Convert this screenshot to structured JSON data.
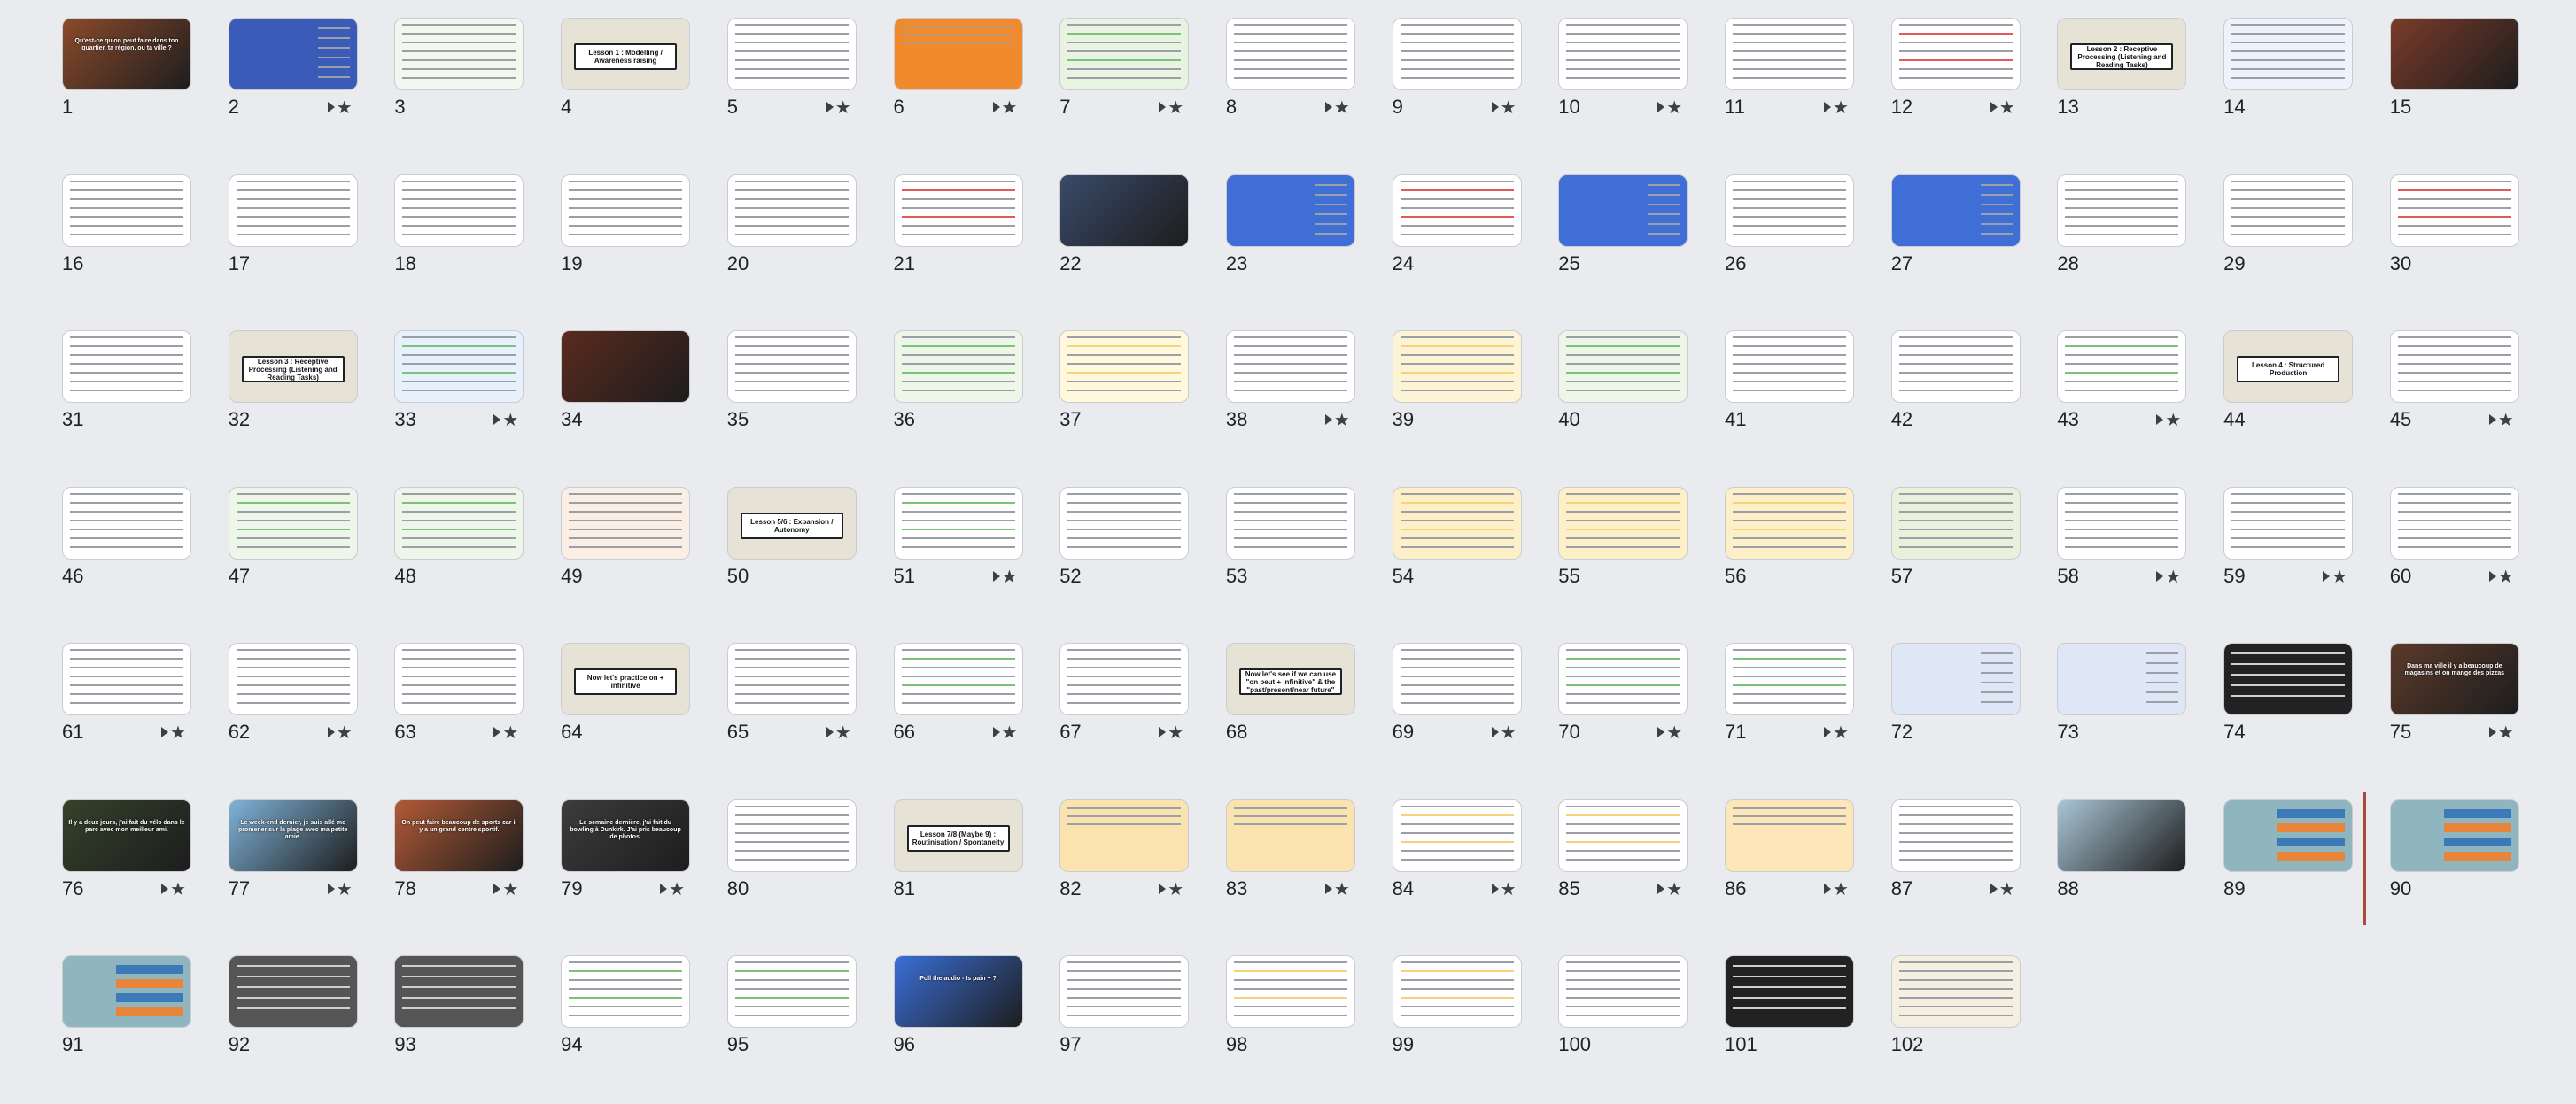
{
  "slide_sorter": {
    "slides": [
      {
        "n": "1",
        "star": false,
        "kind": "image",
        "bg": "#8b4a2b",
        "text": "Qu'est-ce qu'on peut faire dans ton quartier, ta région, ou ta ville ?"
      },
      {
        "n": "2",
        "star": true,
        "kind": "blue",
        "bg": "#3b5bb8"
      },
      {
        "n": "3",
        "star": false,
        "kind": "doc",
        "bg": "#f4f6f0"
      },
      {
        "n": "4",
        "star": false,
        "kind": "title",
        "bg": "#e6e2d6",
        "text": "Lesson 1 : Modelling / Awareness raising"
      },
      {
        "n": "5",
        "star": true,
        "kind": "doc",
        "bg": "#ffffff"
      },
      {
        "n": "6",
        "star": true,
        "kind": "orange",
        "bg": "#f08a2c"
      },
      {
        "n": "7",
        "star": true,
        "kind": "green",
        "bg": "#e9f3e2"
      },
      {
        "n": "8",
        "star": true,
        "kind": "doc",
        "bg": "#ffffff"
      },
      {
        "n": "9",
        "star": true,
        "kind": "doc",
        "bg": "#ffffff"
      },
      {
        "n": "10",
        "star": true,
        "kind": "doc",
        "bg": "#ffffff"
      },
      {
        "n": "11",
        "star": true,
        "kind": "doc",
        "bg": "#ffffff"
      },
      {
        "n": "12",
        "star": true,
        "kind": "red",
        "bg": "#ffffff"
      },
      {
        "n": "13",
        "star": false,
        "kind": "title",
        "bg": "#e6e2d6",
        "text": "Lesson 2 : Receptive Processing (Listening and Reading Tasks)"
      },
      {
        "n": "14",
        "star": false,
        "kind": "doc",
        "bg": "#eef3fb"
      },
      {
        "n": "15",
        "star": false,
        "kind": "image",
        "bg": "#7a3b2a",
        "text": ""
      },
      {
        "n": "16",
        "star": false,
        "kind": "doc",
        "bg": "#ffffff"
      },
      {
        "n": "17",
        "star": false,
        "kind": "doc",
        "bg": "#ffffff"
      },
      {
        "n": "18",
        "star": false,
        "kind": "doc",
        "bg": "#ffffff"
      },
      {
        "n": "19",
        "star": false,
        "kind": "doc",
        "bg": "#ffffff"
      },
      {
        "n": "20",
        "star": false,
        "kind": "doc",
        "bg": "#ffffff"
      },
      {
        "n": "21",
        "star": false,
        "kind": "red",
        "bg": "#ffffff"
      },
      {
        "n": "22",
        "star": false,
        "kind": "image",
        "bg": "#3a4a6a",
        "text": ""
      },
      {
        "n": "23",
        "star": false,
        "kind": "blue",
        "bg": "#3f6ed6"
      },
      {
        "n": "24",
        "star": false,
        "kind": "red",
        "bg": "#ffffff"
      },
      {
        "n": "25",
        "star": false,
        "kind": "blue",
        "bg": "#3f6ed6"
      },
      {
        "n": "26",
        "star": false,
        "kind": "doc",
        "bg": "#ffffff"
      },
      {
        "n": "27",
        "star": false,
        "kind": "blue",
        "bg": "#3f6ed6"
      },
      {
        "n": "28",
        "star": false,
        "kind": "doc",
        "bg": "#ffffff"
      },
      {
        "n": "29",
        "star": false,
        "kind": "doc",
        "bg": "#ffffff"
      },
      {
        "n": "30",
        "star": false,
        "kind": "red",
        "bg": "#ffffff"
      },
      {
        "n": "31",
        "star": false,
        "kind": "doc",
        "bg": "#ffffff"
      },
      {
        "n": "32",
        "star": false,
        "kind": "title",
        "bg": "#e6e2d6",
        "text": "Lesson 3 : Receptive Processing (Listening and Reading Tasks)"
      },
      {
        "n": "33",
        "star": true,
        "kind": "green",
        "bg": "#e7f1fb"
      },
      {
        "n": "34",
        "star": false,
        "kind": "image",
        "bg": "#5a2a1e",
        "text": ""
      },
      {
        "n": "35",
        "star": false,
        "kind": "doc",
        "bg": "#ffffff"
      },
      {
        "n": "36",
        "star": false,
        "kind": "green",
        "bg": "#eef6ea"
      },
      {
        "n": "37",
        "star": false,
        "kind": "yellow",
        "bg": "#fff8dc"
      },
      {
        "n": "38",
        "star": true,
        "kind": "doc",
        "bg": "#ffffff"
      },
      {
        "n": "39",
        "star": false,
        "kind": "yellow",
        "bg": "#fdf4d6"
      },
      {
        "n": "40",
        "star": false,
        "kind": "green",
        "bg": "#eef6ea"
      },
      {
        "n": "41",
        "star": false,
        "kind": "doc",
        "bg": "#ffffff"
      },
      {
        "n": "42",
        "star": false,
        "kind": "doc",
        "bg": "#ffffff"
      },
      {
        "n": "43",
        "star": true,
        "kind": "green",
        "bg": "#ffffff"
      },
      {
        "n": "44",
        "star": false,
        "kind": "title",
        "bg": "#e6e2d6",
        "text": "Lesson 4 : Structured Production"
      },
      {
        "n": "45",
        "star": true,
        "kind": "doc",
        "bg": "#ffffff"
      },
      {
        "n": "46",
        "star": false,
        "kind": "doc",
        "bg": "#ffffff"
      },
      {
        "n": "47",
        "star": false,
        "kind": "green",
        "bg": "#eef6ea"
      },
      {
        "n": "48",
        "star": false,
        "kind": "green",
        "bg": "#eef6ea"
      },
      {
        "n": "49",
        "star": false,
        "kind": "doc",
        "bg": "#fbeee5"
      },
      {
        "n": "50",
        "star": false,
        "kind": "title",
        "bg": "#e6e2d6",
        "text": "Lesson 5/6 : Expansion / Autonomy"
      },
      {
        "n": "51",
        "star": true,
        "kind": "green",
        "bg": "#ffffff"
      },
      {
        "n": "52",
        "star": false,
        "kind": "doc",
        "bg": "#ffffff"
      },
      {
        "n": "53",
        "star": false,
        "kind": "doc",
        "bg": "#ffffff"
      },
      {
        "n": "54",
        "star": false,
        "kind": "yellow",
        "bg": "#fdf0c8"
      },
      {
        "n": "55",
        "star": false,
        "kind": "yellow",
        "bg": "#fdf0c8"
      },
      {
        "n": "56",
        "star": false,
        "kind": "yellow",
        "bg": "#fdf0c8"
      },
      {
        "n": "57",
        "star": false,
        "kind": "doc",
        "bg": "#eaf0dc"
      },
      {
        "n": "58",
        "star": true,
        "kind": "doc",
        "bg": "#ffffff"
      },
      {
        "n": "59",
        "star": true,
        "kind": "doc",
        "bg": "#ffffff"
      },
      {
        "n": "60",
        "star": true,
        "kind": "doc",
        "bg": "#ffffff"
      },
      {
        "n": "61",
        "star": true,
        "kind": "doc",
        "bg": "#ffffff"
      },
      {
        "n": "62",
        "star": true,
        "kind": "doc",
        "bg": "#ffffff"
      },
      {
        "n": "63",
        "star": true,
        "kind": "doc",
        "bg": "#ffffff"
      },
      {
        "n": "64",
        "star": false,
        "kind": "title",
        "bg": "#e6e2d6",
        "text": "Now let's practice on + infinitive"
      },
      {
        "n": "65",
        "star": true,
        "kind": "doc",
        "bg": "#ffffff"
      },
      {
        "n": "66",
        "star": true,
        "kind": "green",
        "bg": "#ffffff"
      },
      {
        "n": "67",
        "star": true,
        "kind": "doc",
        "bg": "#ffffff"
      },
      {
        "n": "68",
        "star": false,
        "kind": "title",
        "bg": "#e6e2d6",
        "text": "Now let's see if we can use \"on peut + infinitive\" & the \"past/present/near future\""
      },
      {
        "n": "69",
        "star": true,
        "kind": "doc",
        "bg": "#ffffff"
      },
      {
        "n": "70",
        "star": true,
        "kind": "green",
        "bg": "#ffffff"
      },
      {
        "n": "71",
        "star": true,
        "kind": "green",
        "bg": "#ffffff"
      },
      {
        "n": "72",
        "star": false,
        "kind": "blue",
        "bg": "#dfe6f5"
      },
      {
        "n": "73",
        "star": false,
        "kind": "blue",
        "bg": "#dfe6f5"
      },
      {
        "n": "74",
        "star": false,
        "kind": "dark",
        "bg": "#222222"
      },
      {
        "n": "75",
        "star": true,
        "kind": "image",
        "bg": "#5b3a2a",
        "text": "Dans ma ville il y a beaucoup de magasins et on mange des pizzas"
      },
      {
        "n": "76",
        "star": true,
        "kind": "image",
        "bg": "#34412a",
        "text": "Il y a deux jours, j'ai fait du vélo dans le parc avec mon meilleur ami."
      },
      {
        "n": "77",
        "star": true,
        "kind": "image",
        "bg": "#7fb3d8",
        "text": "Le week-end dernier, je suis allé me promener sur la plage avec ma petite amie."
      },
      {
        "n": "78",
        "star": true,
        "kind": "image",
        "bg": "#b25a36",
        "text": "On peut faire beaucoup de sports car il y a un grand centre sportif."
      },
      {
        "n": "79",
        "star": true,
        "kind": "image",
        "bg": "#3c3c3c",
        "text": "Le semaine dernière, j'ai fait du bowling à Dunkirk. J'ai pris beaucoup de photos."
      },
      {
        "n": "80",
        "star": false,
        "kind": "doc",
        "bg": "#ffffff"
      },
      {
        "n": "81",
        "star": false,
        "kind": "title",
        "bg": "#e6e2d6",
        "text": "Lesson 7/8 (Maybe 9) : Routinisation / Spontaneity"
      },
      {
        "n": "82",
        "star": true,
        "kind": "orange",
        "bg": "#fbe3b0"
      },
      {
        "n": "83",
        "star": true,
        "kind": "orange",
        "bg": "#fbe3b0"
      },
      {
        "n": "84",
        "star": true,
        "kind": "yellow",
        "bg": "#ffffff"
      },
      {
        "n": "85",
        "star": true,
        "kind": "yellow",
        "bg": "#ffffff"
      },
      {
        "n": "86",
        "star": true,
        "kind": "orange",
        "bg": "#fde6b8"
      },
      {
        "n": "87",
        "star": true,
        "kind": "doc",
        "bg": "#ffffff"
      },
      {
        "n": "88",
        "star": false,
        "kind": "image",
        "bg": "#a9c5d6",
        "text": ""
      },
      {
        "n": "89",
        "star": false,
        "kind": "teal",
        "bg": "#8fb5bf"
      },
      {
        "n": "90",
        "star": false,
        "kind": "teal",
        "bg": "#8fb5bf"
      },
      {
        "n": "91",
        "star": false,
        "kind": "teal",
        "bg": "#8fb5bf"
      },
      {
        "n": "92",
        "star": false,
        "kind": "dark",
        "bg": "#555555"
      },
      {
        "n": "93",
        "star": false,
        "kind": "dark",
        "bg": "#555555"
      },
      {
        "n": "94",
        "star": false,
        "kind": "green",
        "bg": "#ffffff"
      },
      {
        "n": "95",
        "star": false,
        "kind": "green",
        "bg": "#ffffff"
      },
      {
        "n": "96",
        "star": false,
        "kind": "image",
        "bg": "#3a6fd8",
        "text": "Poll the audio - Is pain + ?"
      },
      {
        "n": "97",
        "star": false,
        "kind": "doc",
        "bg": "#ffffff"
      },
      {
        "n": "98",
        "star": false,
        "kind": "yellow",
        "bg": "#ffffff"
      },
      {
        "n": "99",
        "star": false,
        "kind": "yellow",
        "bg": "#ffffff"
      },
      {
        "n": "100",
        "star": false,
        "kind": "doc",
        "bg": "#ffffff"
      },
      {
        "n": "101",
        "star": false,
        "kind": "dark",
        "bg": "#222222"
      },
      {
        "n": "102",
        "star": false,
        "kind": "doc",
        "bg": "#f5efe1"
      }
    ]
  },
  "colors": {
    "background": "#e9ebee",
    "insertion_marker": "#a94a3a"
  }
}
